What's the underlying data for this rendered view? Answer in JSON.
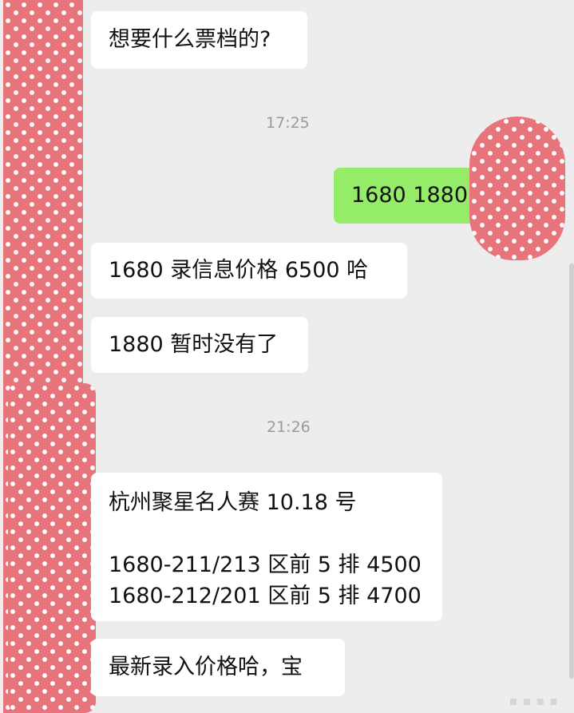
{
  "conversation": {
    "messages": [
      {
        "id": "m1",
        "side": "received",
        "text": "想要什么票档的?"
      },
      {
        "id": "t1",
        "type": "timestamp",
        "text": "17:25"
      },
      {
        "id": "m2",
        "side": "sent",
        "text": "1680 1880"
      },
      {
        "id": "m3",
        "side": "received",
        "text": "1680 录信息价格 6500 哈"
      },
      {
        "id": "m4",
        "side": "received",
        "text": "1880 暂时没有了"
      },
      {
        "id": "t2",
        "type": "timestamp",
        "text": "21:26"
      },
      {
        "id": "m5",
        "side": "received",
        "text": "杭州聚星名人赛 10.18 号\n\n1680-211/213 区前 5 排 4500\n1680-212/201 区前 5 排 4700"
      },
      {
        "id": "m6",
        "side": "received",
        "text": "最新录入价格哈，宝"
      }
    ]
  },
  "theme": {
    "background": "#ededed",
    "received_bubble": "#ffffff",
    "sent_bubble": "#95ec69",
    "mosaic": "#e8757c"
  }
}
